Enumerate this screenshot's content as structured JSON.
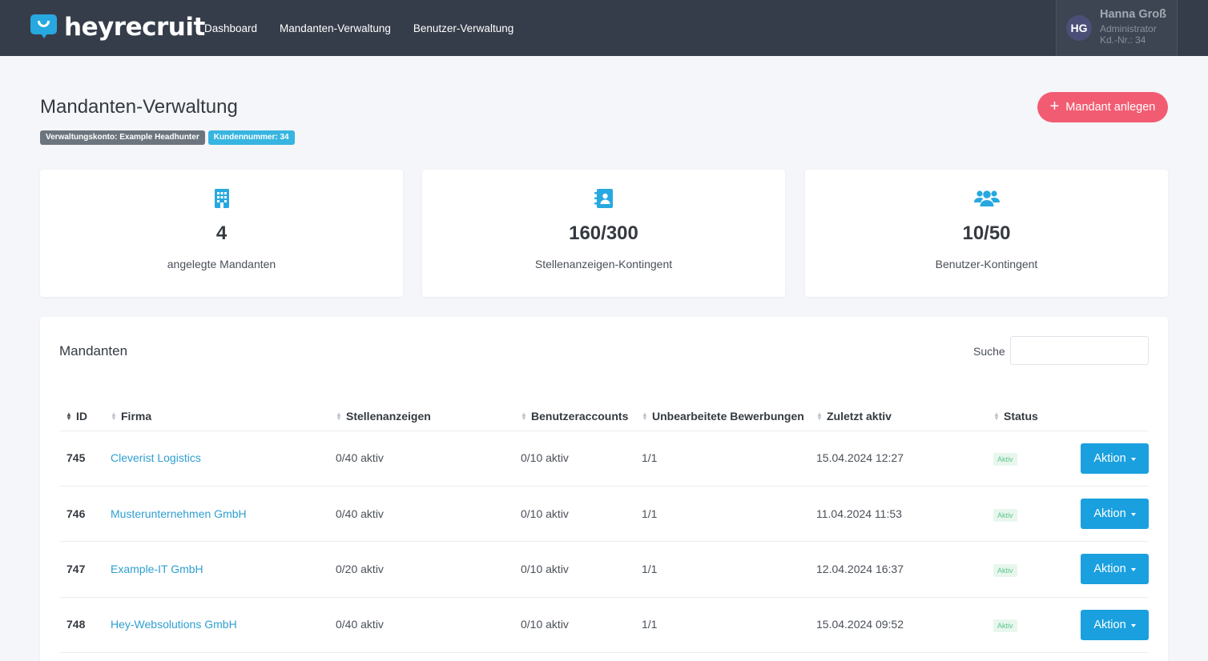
{
  "brand": {
    "name": "heyrecruit"
  },
  "nav": {
    "items": [
      {
        "label": "Dashboard"
      },
      {
        "label": "Mandanten-Verwaltung"
      },
      {
        "label": "Benutzer-Verwaltung"
      }
    ]
  },
  "user": {
    "initials": "HG",
    "name": "Hanna Groß",
    "role": "Administrator",
    "customer_no": "Kd.-Nr.: 34"
  },
  "page": {
    "title": "Mandanten-Verwaltung",
    "badge_account": "Verwaltungskonto: Example Headhunter",
    "badge_customer": "Kundennummer: 34",
    "add_button": "Mandant anlegen"
  },
  "stats": [
    {
      "icon": "building-icon",
      "value": "4",
      "label": "angelegte Mandanten"
    },
    {
      "icon": "contact-book-icon",
      "value": "160/300",
      "label": "Stellenanzeigen-Kontingent"
    },
    {
      "icon": "users-icon",
      "value": "10/50",
      "label": "Benutzer-Kontingent"
    }
  ],
  "table": {
    "title": "Mandanten",
    "search_label": "Suche",
    "search_value": "",
    "columns": [
      "ID",
      "Firma",
      "Stellenanzeigen",
      "Benutzeraccounts",
      "Unbearbeitete Bewerbungen",
      "Zuletzt aktiv",
      "Status"
    ],
    "action_label": "Aktion",
    "rows": [
      {
        "id": "745",
        "firma": "Cleverist Logistics",
        "stellen": "0/40 aktiv",
        "benutzer": "0/10 aktiv",
        "bewerbungen": "1/1",
        "zuletzt": "15.04.2024 12:27",
        "status": "Aktiv"
      },
      {
        "id": "746",
        "firma": "Musterunternehmen GmbH",
        "stellen": "0/40 aktiv",
        "benutzer": "0/10 aktiv",
        "bewerbungen": "1/1",
        "zuletzt": "11.04.2024 11:53",
        "status": "Aktiv"
      },
      {
        "id": "747",
        "firma": "Example-IT GmbH",
        "stellen": "0/20 aktiv",
        "benutzer": "0/10 aktiv",
        "bewerbungen": "1/1",
        "zuletzt": "12.04.2024 16:37",
        "status": "Aktiv"
      },
      {
        "id": "748",
        "firma": "Hey-Websolutions GmbH",
        "stellen": "0/40 aktiv",
        "benutzer": "0/10 aktiv",
        "bewerbungen": "1/1",
        "zuletzt": "15.04.2024 09:52",
        "status": "Aktiv"
      }
    ]
  },
  "colors": {
    "topbar": "#363d4a",
    "accent": "#28a8e0",
    "add_button": "#f25c72",
    "action_button": "#1aa0de",
    "status_green": "#5cc48a"
  }
}
